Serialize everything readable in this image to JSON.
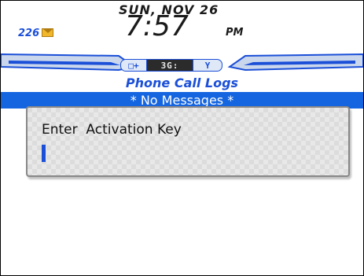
{
  "status": {
    "date": "SUN, NOV 26",
    "time": "7:57",
    "ampm": "PM",
    "message_count": "226",
    "network": "3G",
    "network_label": "3G:",
    "left_pill_glyph": "□+",
    "right_pill_glyph": "Y"
  },
  "section_title": "Phone Call Logs",
  "messages_banner": "* No Messages *",
  "dialog": {
    "label": "Enter  Activation Key",
    "input_value": ""
  },
  "colors": {
    "accent": "#1b4fd8",
    "highlight_bar": "#1565e0"
  }
}
